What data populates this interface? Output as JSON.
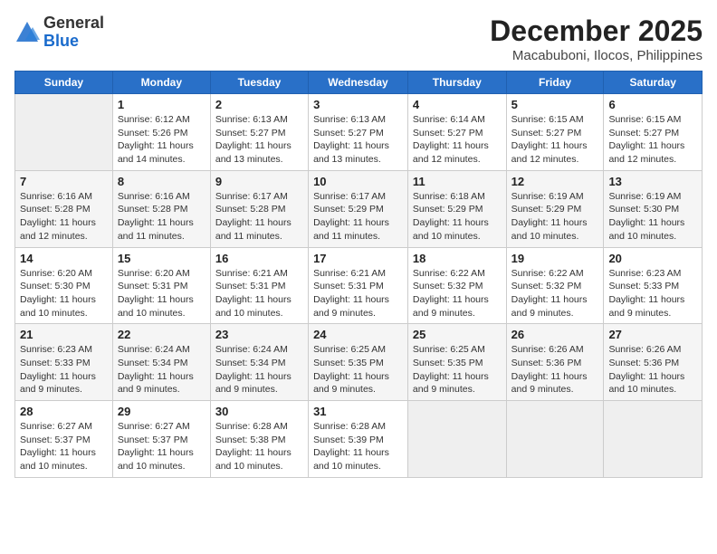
{
  "header": {
    "logo_general": "General",
    "logo_blue": "Blue",
    "month_title": "December 2025",
    "location": "Macabuboni, Ilocos, Philippines"
  },
  "weekdays": [
    "Sunday",
    "Monday",
    "Tuesday",
    "Wednesday",
    "Thursday",
    "Friday",
    "Saturday"
  ],
  "weeks": [
    [
      {
        "day": "",
        "empty": true
      },
      {
        "day": "1",
        "sunrise": "6:12 AM",
        "sunset": "5:26 PM",
        "daylight": "11 hours and 14 minutes."
      },
      {
        "day": "2",
        "sunrise": "6:13 AM",
        "sunset": "5:27 PM",
        "daylight": "11 hours and 13 minutes."
      },
      {
        "day": "3",
        "sunrise": "6:13 AM",
        "sunset": "5:27 PM",
        "daylight": "11 hours and 13 minutes."
      },
      {
        "day": "4",
        "sunrise": "6:14 AM",
        "sunset": "5:27 PM",
        "daylight": "11 hours and 12 minutes."
      },
      {
        "day": "5",
        "sunrise": "6:15 AM",
        "sunset": "5:27 PM",
        "daylight": "11 hours and 12 minutes."
      },
      {
        "day": "6",
        "sunrise": "6:15 AM",
        "sunset": "5:27 PM",
        "daylight": "11 hours and 12 minutes."
      }
    ],
    [
      {
        "day": "7",
        "sunrise": "6:16 AM",
        "sunset": "5:28 PM",
        "daylight": "11 hours and 12 minutes."
      },
      {
        "day": "8",
        "sunrise": "6:16 AM",
        "sunset": "5:28 PM",
        "daylight": "11 hours and 11 minutes."
      },
      {
        "day": "9",
        "sunrise": "6:17 AM",
        "sunset": "5:28 PM",
        "daylight": "11 hours and 11 minutes."
      },
      {
        "day": "10",
        "sunrise": "6:17 AM",
        "sunset": "5:29 PM",
        "daylight": "11 hours and 11 minutes."
      },
      {
        "day": "11",
        "sunrise": "6:18 AM",
        "sunset": "5:29 PM",
        "daylight": "11 hours and 10 minutes."
      },
      {
        "day": "12",
        "sunrise": "6:19 AM",
        "sunset": "5:29 PM",
        "daylight": "11 hours and 10 minutes."
      },
      {
        "day": "13",
        "sunrise": "6:19 AM",
        "sunset": "5:30 PM",
        "daylight": "11 hours and 10 minutes."
      }
    ],
    [
      {
        "day": "14",
        "sunrise": "6:20 AM",
        "sunset": "5:30 PM",
        "daylight": "11 hours and 10 minutes."
      },
      {
        "day": "15",
        "sunrise": "6:20 AM",
        "sunset": "5:31 PM",
        "daylight": "11 hours and 10 minutes."
      },
      {
        "day": "16",
        "sunrise": "6:21 AM",
        "sunset": "5:31 PM",
        "daylight": "11 hours and 10 minutes."
      },
      {
        "day": "17",
        "sunrise": "6:21 AM",
        "sunset": "5:31 PM",
        "daylight": "11 hours and 9 minutes."
      },
      {
        "day": "18",
        "sunrise": "6:22 AM",
        "sunset": "5:32 PM",
        "daylight": "11 hours and 9 minutes."
      },
      {
        "day": "19",
        "sunrise": "6:22 AM",
        "sunset": "5:32 PM",
        "daylight": "11 hours and 9 minutes."
      },
      {
        "day": "20",
        "sunrise": "6:23 AM",
        "sunset": "5:33 PM",
        "daylight": "11 hours and 9 minutes."
      }
    ],
    [
      {
        "day": "21",
        "sunrise": "6:23 AM",
        "sunset": "5:33 PM",
        "daylight": "11 hours and 9 minutes."
      },
      {
        "day": "22",
        "sunrise": "6:24 AM",
        "sunset": "5:34 PM",
        "daylight": "11 hours and 9 minutes."
      },
      {
        "day": "23",
        "sunrise": "6:24 AM",
        "sunset": "5:34 PM",
        "daylight": "11 hours and 9 minutes."
      },
      {
        "day": "24",
        "sunrise": "6:25 AM",
        "sunset": "5:35 PM",
        "daylight": "11 hours and 9 minutes."
      },
      {
        "day": "25",
        "sunrise": "6:25 AM",
        "sunset": "5:35 PM",
        "daylight": "11 hours and 9 minutes."
      },
      {
        "day": "26",
        "sunrise": "6:26 AM",
        "sunset": "5:36 PM",
        "daylight": "11 hours and 9 minutes."
      },
      {
        "day": "27",
        "sunrise": "6:26 AM",
        "sunset": "5:36 PM",
        "daylight": "11 hours and 10 minutes."
      }
    ],
    [
      {
        "day": "28",
        "sunrise": "6:27 AM",
        "sunset": "5:37 PM",
        "daylight": "11 hours and 10 minutes."
      },
      {
        "day": "29",
        "sunrise": "6:27 AM",
        "sunset": "5:37 PM",
        "daylight": "11 hours and 10 minutes."
      },
      {
        "day": "30",
        "sunrise": "6:28 AM",
        "sunset": "5:38 PM",
        "daylight": "11 hours and 10 minutes."
      },
      {
        "day": "31",
        "sunrise": "6:28 AM",
        "sunset": "5:39 PM",
        "daylight": "11 hours and 10 minutes."
      },
      {
        "day": "",
        "empty": true
      },
      {
        "day": "",
        "empty": true
      },
      {
        "day": "",
        "empty": true
      }
    ]
  ]
}
